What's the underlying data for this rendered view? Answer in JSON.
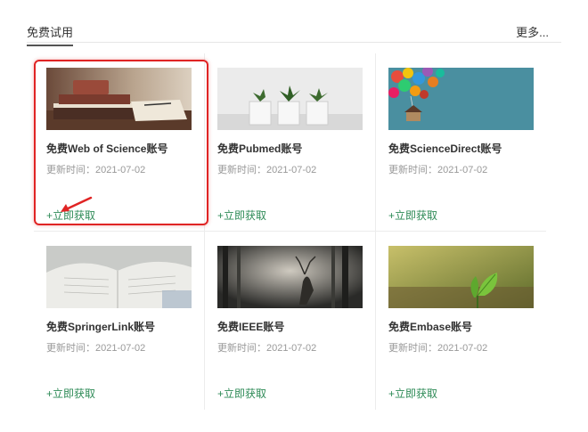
{
  "header": {
    "title": "免费试用",
    "more_label": "更多..."
  },
  "cards": [
    {
      "title": "免费Web of Science账号",
      "date": "更新时间：2021-07-02",
      "action": "+立即获取",
      "image": "books-image"
    },
    {
      "title": "免费Pubmed账号",
      "date": "更新时间：2021-07-02",
      "action": "+立即获取",
      "image": "plants-image"
    },
    {
      "title": "免费ScienceDirect账号",
      "date": "更新时间：2021-07-02",
      "action": "+立即获取",
      "image": "balloon-house-image"
    },
    {
      "title": "免费SpringerLink账号",
      "date": "更新时间：2021-07-02",
      "action": "+立即获取",
      "image": "open-book-image"
    },
    {
      "title": "免费IEEE账号",
      "date": "更新时间：2021-07-02",
      "action": "+立即获取",
      "image": "deer-forest-image"
    },
    {
      "title": "免费Embase账号",
      "date": "更新时间：2021-07-02",
      "action": "+立即获取",
      "image": "leaf-image"
    }
  ],
  "colors": {
    "link": "#2e8b57",
    "highlight": "#e02424"
  }
}
